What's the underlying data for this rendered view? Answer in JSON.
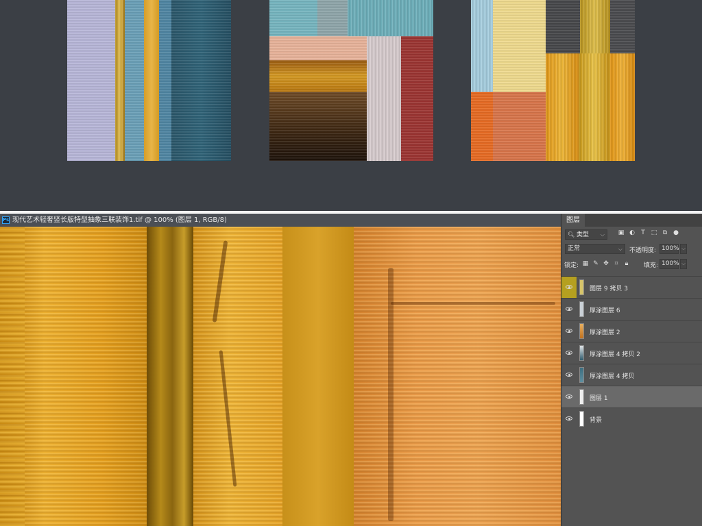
{
  "document_tab": {
    "title": "现代艺术轻奢竖长版特型抽象三联装饰1.tif @ 100% (图层 1, RGB/8)",
    "app_badge": "Ps",
    "close_glyph": "×"
  },
  "layers_panel": {
    "tab_label": "图层",
    "filter_kind": "类型",
    "blend_mode": "正常",
    "opacity_label": "不透明度:",
    "opacity_value": "100%",
    "lock_label": "锁定:",
    "fill_label": "填充:",
    "fill_value": "100%",
    "layers": [
      {
        "name": "图层 9 拷贝 3",
        "visible": true,
        "thumb_color": "#d8c86a",
        "eye_highlight": true
      },
      {
        "name": "厚涂图层 6",
        "visible": true,
        "thumb_color": "#c9d0d6"
      },
      {
        "name": "厚涂图层 2",
        "visible": true,
        "thumb_color": "#c87a28"
      },
      {
        "name": "厚涂图层 4 拷贝 2",
        "visible": true,
        "thumb_color": "#2e5a6c"
      },
      {
        "name": "厚涂图层 4 拷贝",
        "visible": true,
        "thumb_color": "#3d6e80"
      },
      {
        "name": "图层 1",
        "visible": true,
        "thumb_color": "#e8e8e8",
        "selected": true
      },
      {
        "name": "背景",
        "visible": true,
        "thumb_color": "#ffffff"
      }
    ]
  },
  "colors": {
    "lavender": "#b9b8da",
    "gold": "#d8a52a",
    "teal": "#2c5f74",
    "aqua": "#79b7c2",
    "peach": "#e9b197",
    "ochre": "#c98a17",
    "brown": "#4b2a12",
    "blush": "#d9cfd0",
    "red": "#9d3633",
    "butter": "#efd98c",
    "charcoal": "#454649",
    "orange": "#e86a22",
    "amber": "#e59a1b",
    "canvas_orange": "#ea9b45"
  },
  "icons": {
    "search": "search-icon",
    "eye": "eye-icon",
    "lock": "lock-icon",
    "move": "move-icon",
    "brush": "brush-icon"
  }
}
